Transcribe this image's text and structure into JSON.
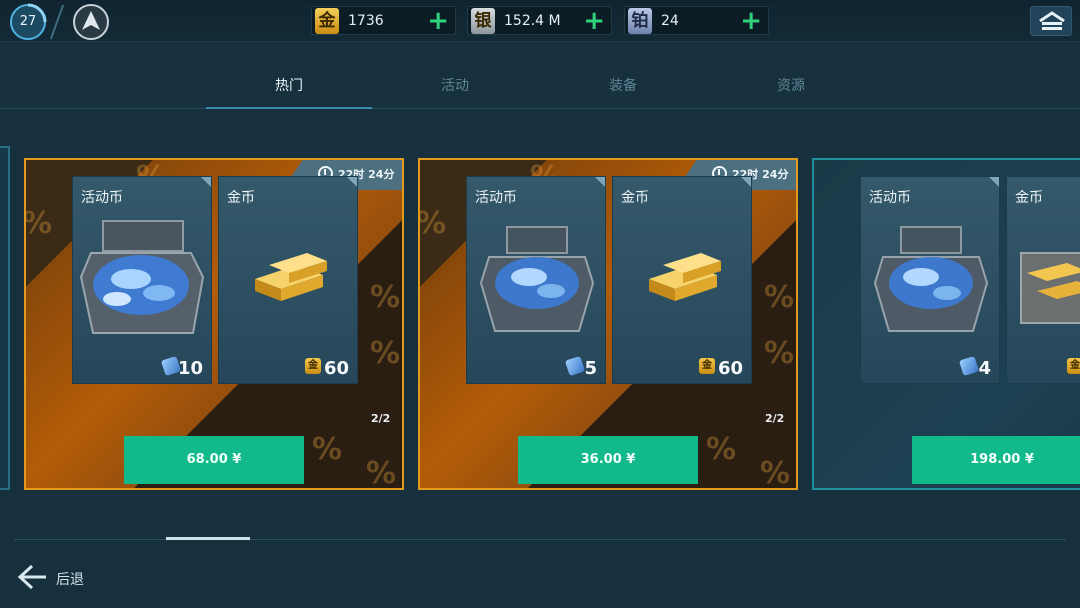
{
  "player": {
    "level": "27"
  },
  "currencies": [
    {
      "glyph": "金",
      "value": "1736",
      "color": "#e2b23a"
    },
    {
      "glyph": "银",
      "value": "152.4 M",
      "color": "#aeb7be"
    },
    {
      "glyph": "铂",
      "value": "24",
      "color": "#8fa3c8"
    }
  ],
  "add_glyph": "+",
  "tabs": [
    "热门",
    "活动",
    "装备",
    "资源"
  ],
  "active_tab": "热门",
  "offers": [
    {
      "timer": "22时 24分",
      "items": [
        {
          "name": "活动币",
          "qty": "10",
          "icon": "event-coin-icon"
        },
        {
          "name": "金币",
          "qty": "60",
          "icon": "gold-coin-icon"
        }
      ],
      "limit": "2/2",
      "price": "68.00 ¥",
      "style": "featured"
    },
    {
      "timer": "22时 24分",
      "items": [
        {
          "name": "活动币",
          "qty": "5",
          "icon": "event-coin-icon"
        },
        {
          "name": "金币",
          "qty": "60",
          "icon": "gold-coin-icon"
        }
      ],
      "limit": "2/2",
      "price": "36.00 ¥",
      "style": "featured"
    },
    {
      "timer": "",
      "items": [
        {
          "name": "活动币",
          "qty": "4",
          "icon": "event-coin-icon"
        },
        {
          "name": "金币",
          "qty": "",
          "icon": "gold-coin-icon"
        }
      ],
      "limit": "",
      "price": "198.00 ¥",
      "style": "normal"
    }
  ],
  "pct_glyph": "%",
  "gold_glyph": "金",
  "back_label": "后退",
  "colors": {
    "accent_gold": "#e39a1c",
    "buy_green": "#12b98a",
    "plus_green": "#2fd27a"
  }
}
